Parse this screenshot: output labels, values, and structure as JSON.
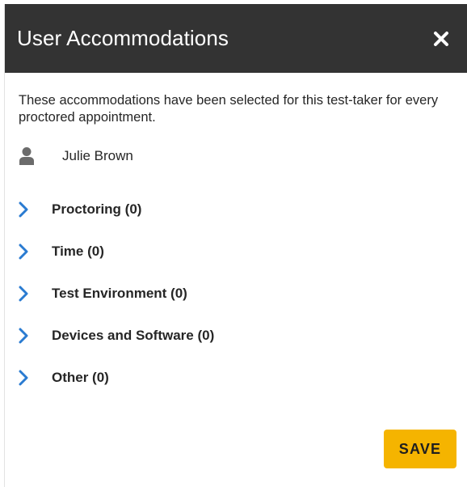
{
  "modal": {
    "title": "User Accommodations",
    "close_icon": "close-icon"
  },
  "description": "These accommodations have been selected for this test-taker for every proctored appointment.",
  "user": {
    "icon": "user-icon",
    "name": "Julie Brown"
  },
  "accordion": {
    "items": [
      {
        "label": "Proctoring (0)"
      },
      {
        "label": "Time (0)"
      },
      {
        "label": "Test Environment (0)"
      },
      {
        "label": "Devices and Software (0)"
      },
      {
        "label": "Other (0)"
      }
    ]
  },
  "footer": {
    "save_label": "SAVE"
  },
  "colors": {
    "header_bg": "#333333",
    "accent_chevron": "#2a7bd1",
    "save_button": "#f5b400"
  }
}
